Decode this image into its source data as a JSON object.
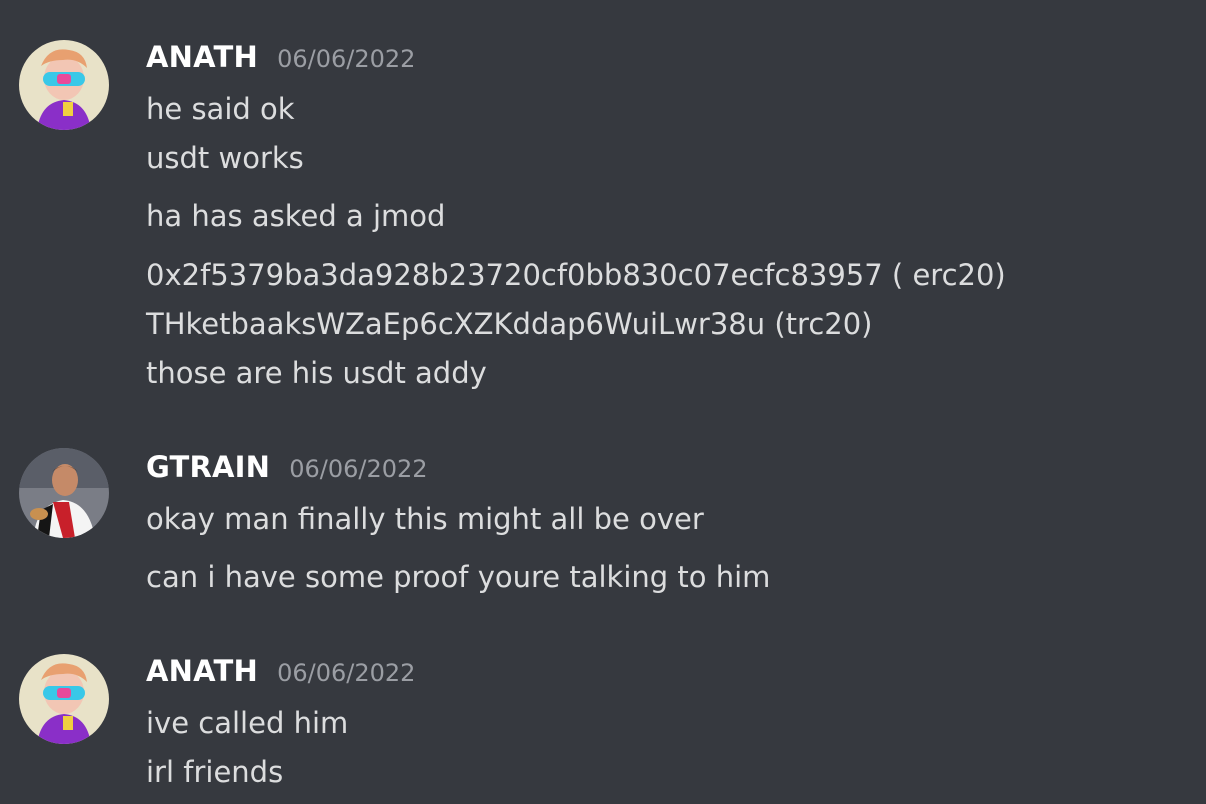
{
  "messages": [
    {
      "username": "ANATH",
      "timestamp": "06/06/2022",
      "lines": [
        "he said ok",
        "usdt works",
        "ha has asked a jmod",
        "0x2f5379ba3da928b23720cf0bb830c07ecfc83957 ( erc20)",
        "THketbaaksWZaEp6cXZKddap6WuiLwr38u (trc20)",
        "those are his usdt addy"
      ]
    },
    {
      "username": "GTRAIN",
      "timestamp": "06/06/2022",
      "lines": [
        "okay man finally this might all be over",
        "can i have some proof youre talking to him"
      ]
    },
    {
      "username": "ANATH",
      "timestamp": "06/06/2022",
      "lines": [
        "ive called him",
        "irl friends"
      ]
    }
  ],
  "colors": {
    "background": "#36393f",
    "username": "#ffffff",
    "timestamp": "#9b9ea4",
    "message_text": "#dcddde"
  }
}
